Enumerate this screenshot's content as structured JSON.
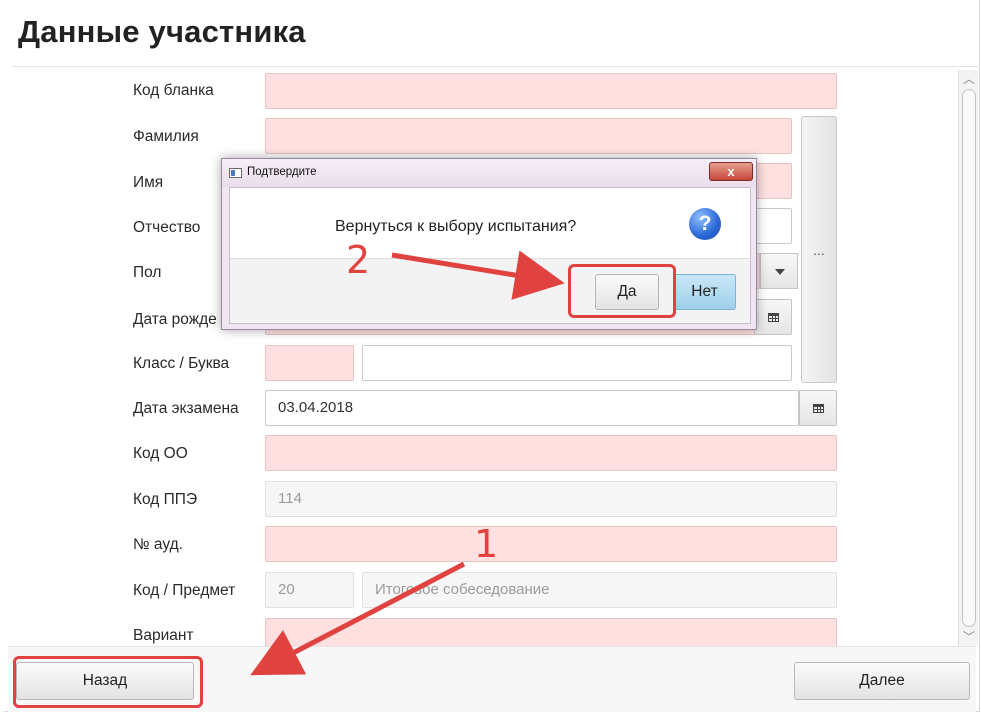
{
  "page": {
    "title": "Данные участника"
  },
  "form": {
    "labels": {
      "blank_code": "Код бланка",
      "last_name": "Фамилия",
      "first_name": "Имя",
      "patronymic": "Отчество",
      "gender": "Пол",
      "birth_date": "Дата рожде",
      "class_letter": "Класс / Буква",
      "exam_date": "Дата экзамена",
      "oo_code": "Код ОО",
      "ppe_code": "Код ППЭ",
      "room_no": "№ ауд.",
      "subject_code": "Код / Предмет",
      "variant": "Вариант"
    },
    "values": {
      "exam_date": "03.04.2018",
      "ppe_code": "114",
      "subject_code": "20",
      "subject_name": "Итоговое собеседование"
    },
    "side_button_label": "..."
  },
  "footer": {
    "back_label": "Назад",
    "next_label": "Далее"
  },
  "dialog": {
    "title": "Подтвердите",
    "close_label": "x",
    "message": "Вернуться к выбору испытания?",
    "question_mark": "?",
    "yes_label": "Да",
    "no_label": "Нет"
  },
  "annotations": {
    "step_1": "1",
    "step_2": "2",
    "color": "#e0433f"
  },
  "scrollbar": {
    "up": "︿",
    "down": "﹀"
  }
}
